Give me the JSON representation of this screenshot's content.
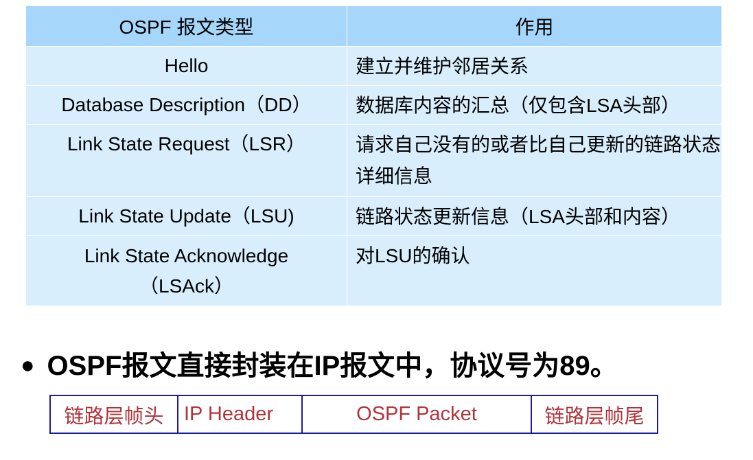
{
  "table": {
    "headers": [
      "OSPF 报文类型",
      "作用"
    ],
    "rows": [
      {
        "type": "Hello",
        "function": "建立并维护邻居关系"
      },
      {
        "type": "Database Description（DD）",
        "function": "数据库内容的汇总（仅包含LSA头部）"
      },
      {
        "type": "Link State Request（LSR）",
        "function": "请求自己没有的或者比自己更新的链路状态详细信息"
      },
      {
        "type": "Link State Update（LSU)",
        "function": "链路状态更新信息（LSA头部和内容）"
      },
      {
        "type": "Link State Acknowledge（LSAck）",
        "function": "对LSU的确认"
      }
    ]
  },
  "bullet": {
    "symbol": "●",
    "text": "OSPF报文直接封装在IP报文中，协议号为89。"
  },
  "frame": {
    "segments": [
      "链路层帧头",
      "IP Header",
      "OSPF Packet",
      "链路层帧尾"
    ],
    "text_color": "#b0343a",
    "border_color": "#1a1aa6"
  },
  "colors": {
    "header_bg": "#a6d6fa",
    "row_bg": "#d9eefc"
  }
}
